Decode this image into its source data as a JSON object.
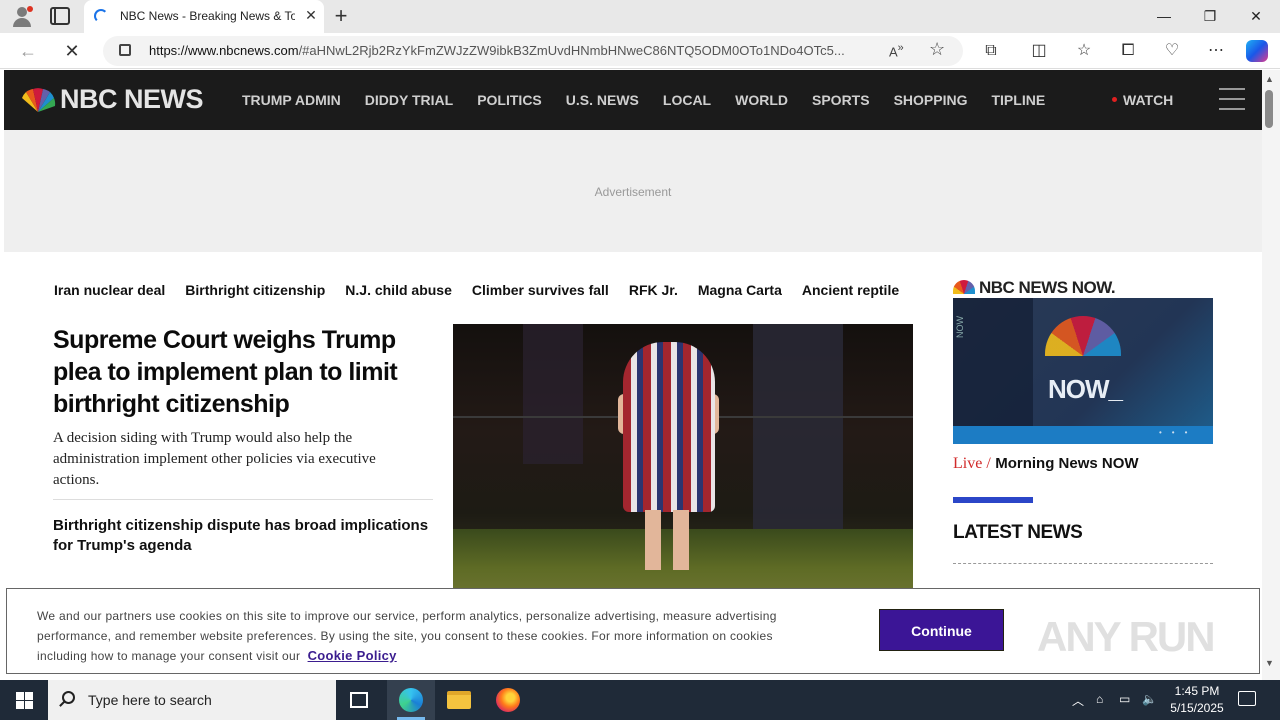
{
  "browser": {
    "tab_title": "NBC News - Breaking News & To",
    "url_domain": "https://www.nbcnews.com",
    "url_rest": "/#aHNwL2Rjb2RzYkFmZWJzZW9ibkB3ZmUvdHNmbHNweC86NTQ5ODM0OTo1NDo4OTc5..."
  },
  "nbc": {
    "logo_text": "NBC NEWS",
    "nav": [
      "TRUMP ADMIN",
      "DIDDY TRIAL",
      "POLITICS",
      "U.S. NEWS",
      "LOCAL",
      "WORLD",
      "SPORTS",
      "SHOPPING",
      "TIPLINE"
    ],
    "watch_label": "WATCH",
    "ad_label": "Advertisement",
    "topics": [
      "Iran nuclear deal",
      "Birthright citizenship",
      "N.J. child abuse",
      "Climber survives fall",
      "RFK Jr.",
      "Magna Carta",
      "Ancient reptile"
    ],
    "headline": "Supreme Court weighs Trump plea to implement plan to limit birthright citizenship",
    "dek": "A decision siding with Trump would also help the administration implement other policies via executive actions.",
    "related": "Birthright citizenship dispute has broad implications for Trump's agenda",
    "now_logo": "NBC NEWS NOW.",
    "now_video_text": "NOW_",
    "now_side_label": "NOW",
    "live_label": "Live /",
    "live_show": "Morning News NOW",
    "latest_heading": "LATEST NEWS"
  },
  "cookie": {
    "text": "We and our partners use cookies on this site to improve our service, perform analytics, personalize advertising, measure advertising performance, and remember website preferences. By using the site, you consent to these cookies. For more information on cookies including how to manage your consent visit our",
    "link": "Cookie Policy",
    "button": "Continue",
    "watermark": "ANY RUN"
  },
  "taskbar": {
    "search_placeholder": "Type here to search",
    "time": "1:45 PM",
    "date": "5/15/2025"
  },
  "icons": {
    "profile": "profile-icon",
    "tab_actions": "tab-actions-icon",
    "back": "back-arrow-icon",
    "reload": "stop-icon",
    "lock": "lock-icon",
    "read_aloud": "read-aloud-icon",
    "favorite": "star-icon",
    "extensions": "puzzle-icon",
    "split": "split-screen-icon",
    "favorites": "favorites-icon",
    "collections": "collections-icon",
    "more": "ellipsis-icon",
    "copilot": "copilot-icon"
  },
  "colors": {
    "nbc_header": "#1b1b1b",
    "live_red": "#d12a2a",
    "continue_button": "#3b1596",
    "accent_blue": "#2b46c8"
  }
}
